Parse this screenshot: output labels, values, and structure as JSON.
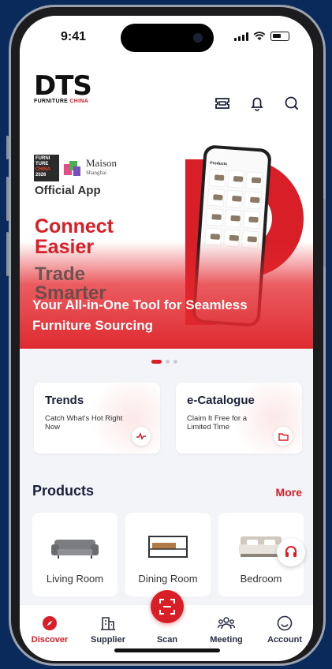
{
  "status_bar": {
    "time": "9:41"
  },
  "header": {
    "logo_main": "DTS",
    "logo_sub_prefix": "FURNITURE ",
    "logo_sub_accent": "CHINA"
  },
  "banner": {
    "badge_line1": "FURNI",
    "badge_line2": "TURE",
    "badge_line3": "CHINA",
    "badge_year": "2026",
    "maison_name": "Maison",
    "maison_city": "Shanghai",
    "official_label": "Official App",
    "headline_line1": "Connect",
    "headline_line2": "Easier",
    "subhead_line1": "Trade",
    "subhead_line2": "Smarter",
    "tagline": "Your All-in-One Tool for Seamless Furniture Sourcing",
    "mock_screen_title": "Products"
  },
  "carousel": {
    "total": 3,
    "active_index": 0
  },
  "quick_cards": [
    {
      "title": "Trends",
      "subtitle": "Catch What's Hot Right Now",
      "icon": "trend-chart-icon"
    },
    {
      "title": "e-Catalogue",
      "subtitle": "Claim It Free for a Limited Time",
      "icon": "folder-icon"
    }
  ],
  "products": {
    "title": "Products",
    "more_label": "More",
    "items": [
      {
        "label": "Living Room",
        "icon": "sofa-icon"
      },
      {
        "label": "Dining Room",
        "icon": "table-icon"
      },
      {
        "label": "Bedroom",
        "icon": "bed-icon"
      }
    ]
  },
  "tabs": [
    {
      "label": "Discover",
      "icon": "compass-icon",
      "active": true
    },
    {
      "label": "Supplier",
      "icon": "building-icon",
      "active": false
    },
    {
      "label": "Scan",
      "icon": "scan-icon",
      "active": false
    },
    {
      "label": "Meeting",
      "icon": "people-icon",
      "active": false
    },
    {
      "label": "Account",
      "icon": "smile-icon",
      "active": false
    }
  ],
  "colors": {
    "brand_red": "#d81e27",
    "navy_text": "#1a1f3a",
    "background": "#0b2a5c"
  }
}
